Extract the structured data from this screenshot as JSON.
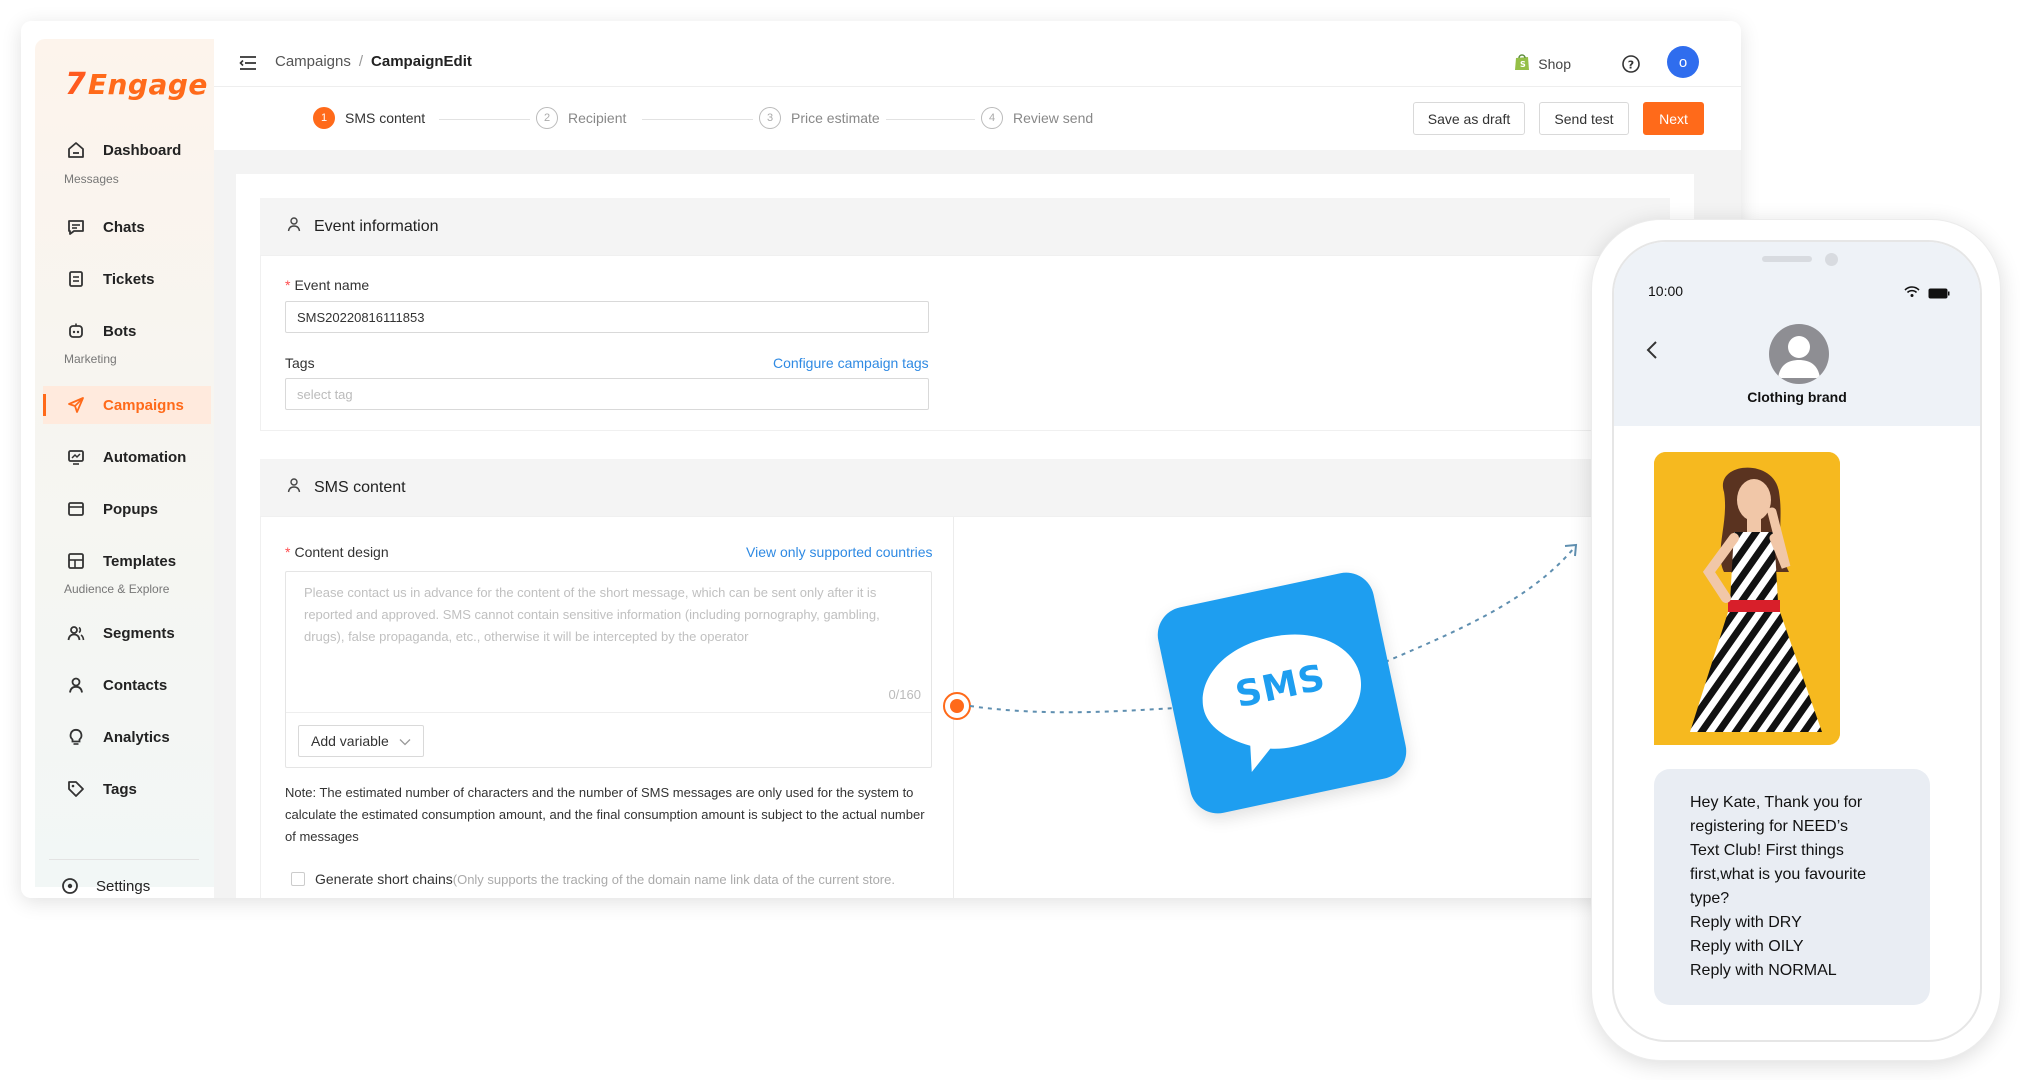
{
  "brand": {
    "logo_mark": "7",
    "logo_text": "Engage",
    "accent": "#ff6a1a"
  },
  "sidebar": {
    "sections": {
      "messages": "Messages",
      "marketing": "Marketing",
      "audience": "Audience & Explore"
    },
    "items": [
      {
        "label": "Dashboard",
        "icon": "home-icon"
      },
      {
        "label": "Chats",
        "icon": "chat-icon"
      },
      {
        "label": "Tickets",
        "icon": "ticket-icon"
      },
      {
        "label": "Bots",
        "icon": "bot-icon"
      },
      {
        "label": "Campaigns",
        "icon": "send-icon",
        "active": true
      },
      {
        "label": "Automation",
        "icon": "automation-icon"
      },
      {
        "label": "Popups",
        "icon": "popup-icon"
      },
      {
        "label": "Templates",
        "icon": "template-icon"
      },
      {
        "label": "Segments",
        "icon": "segments-icon"
      },
      {
        "label": "Contacts",
        "icon": "contact-icon"
      },
      {
        "label": "Analytics",
        "icon": "bulb-icon"
      },
      {
        "label": "Tags",
        "icon": "tag-icon"
      },
      {
        "label": "Settings",
        "icon": "settings-icon"
      }
    ]
  },
  "header": {
    "breadcrumb": {
      "parent": "Campaigns",
      "separator": "/",
      "current": "CampaignEdit"
    },
    "shop_label": "Shop",
    "avatar_initial": "o"
  },
  "steps": [
    {
      "num": "1",
      "label": "SMS content",
      "active": true
    },
    {
      "num": "2",
      "label": "Recipient"
    },
    {
      "num": "3",
      "label": "Price estimate"
    },
    {
      "num": "4",
      "label": "Review send"
    }
  ],
  "actions": {
    "save_draft": "Save as draft",
    "send_test": "Send test",
    "next": "Next"
  },
  "event_section": {
    "title": "Event information",
    "event_name_label": "Event name",
    "event_name_value": "SMS20220816111853",
    "tags_label": "Tags",
    "tags_link": "Configure campaign tags",
    "tags_placeholder": "select tag"
  },
  "sms_section": {
    "title": "SMS content",
    "content_label": "Content design",
    "content_link": "View only supported countries",
    "content_placeholder": "Please contact us in advance for the content of the short message, which can be sent only after it is reported and approved. SMS cannot contain sensitive information (including pornography, gambling, drugs), false propaganda, etc., otherwise it will be intercepted by the operator",
    "counter": "0/160",
    "add_variable": "Add variable",
    "note": "Note: The estimated number of characters and the number of SMS messages are only used for the system to calculate the estimated consumption amount, and the final consumption amount is subject to the actual number of messages",
    "short_chain_label": "Generate short chains",
    "short_chain_hint": "(Only supports the tracking of the domain name link data of the current store."
  },
  "illustration": {
    "sms_badge": "SMS",
    "tile_color": "#1e9ef0"
  },
  "phone": {
    "time": "10:00",
    "contact_name": "Clothing brand",
    "message_lines": [
      "Hey Kate, Thank you for",
      "registering for NEED’s",
      "Text Club! First things",
      "first,what is you favourite",
      "type?",
      "Reply with DRY",
      "Reply with OILY",
      "Reply with NORMAL"
    ]
  }
}
